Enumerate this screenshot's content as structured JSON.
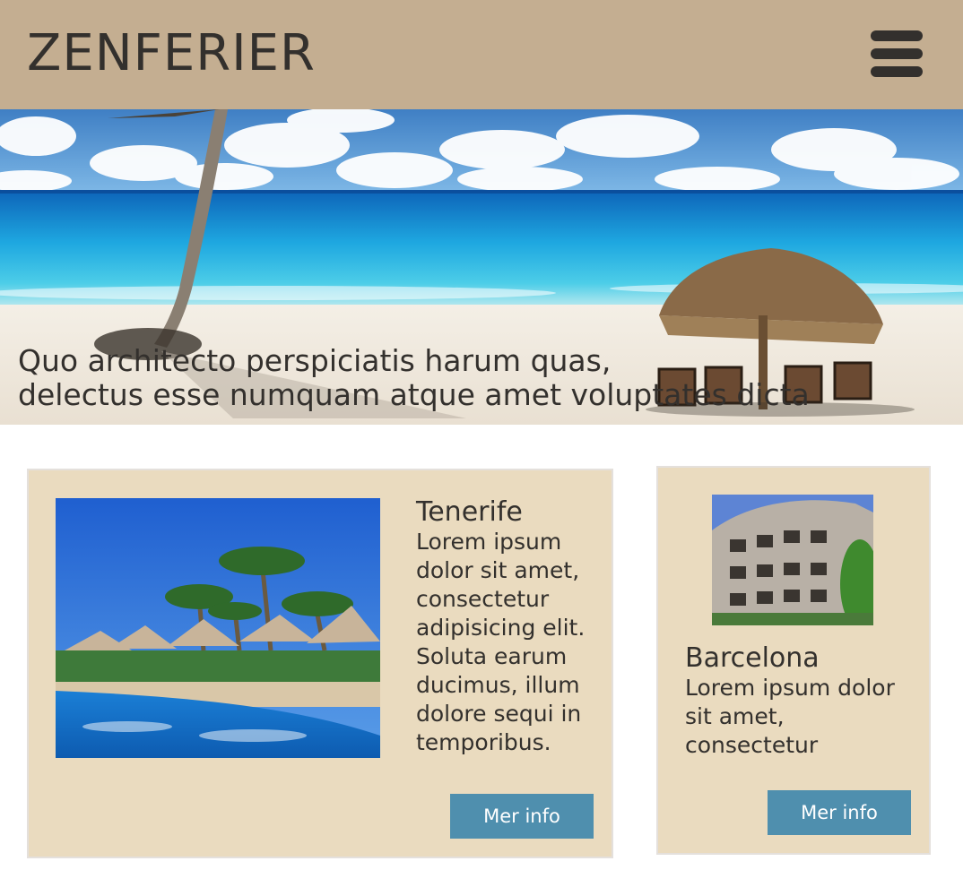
{
  "header": {
    "brand": "ZENFERIER",
    "menu_icon": "hamburger-menu-icon"
  },
  "hero": {
    "line1": "Quo architecto perspiciatis harum quas,",
    "line2": "delectus esse numquam atque amet voluptates dicta"
  },
  "cards": [
    {
      "title": "Tenerife",
      "text": "Lorem ipsum dolor sit amet, consectetur adipisicing elit. Soluta earum ducimus, illum dolore sequi in temporibus.",
      "button": "Mer info"
    },
    {
      "title": "Barcelona",
      "text": "Lorem ipsum dolor sit amet, consectetur",
      "button": "Mer info"
    }
  ],
  "colors": {
    "header_bg": "#c4ae91",
    "card_bg": "#eadbbf",
    "button_bg": "#4f8fae",
    "text": "#33302d"
  }
}
